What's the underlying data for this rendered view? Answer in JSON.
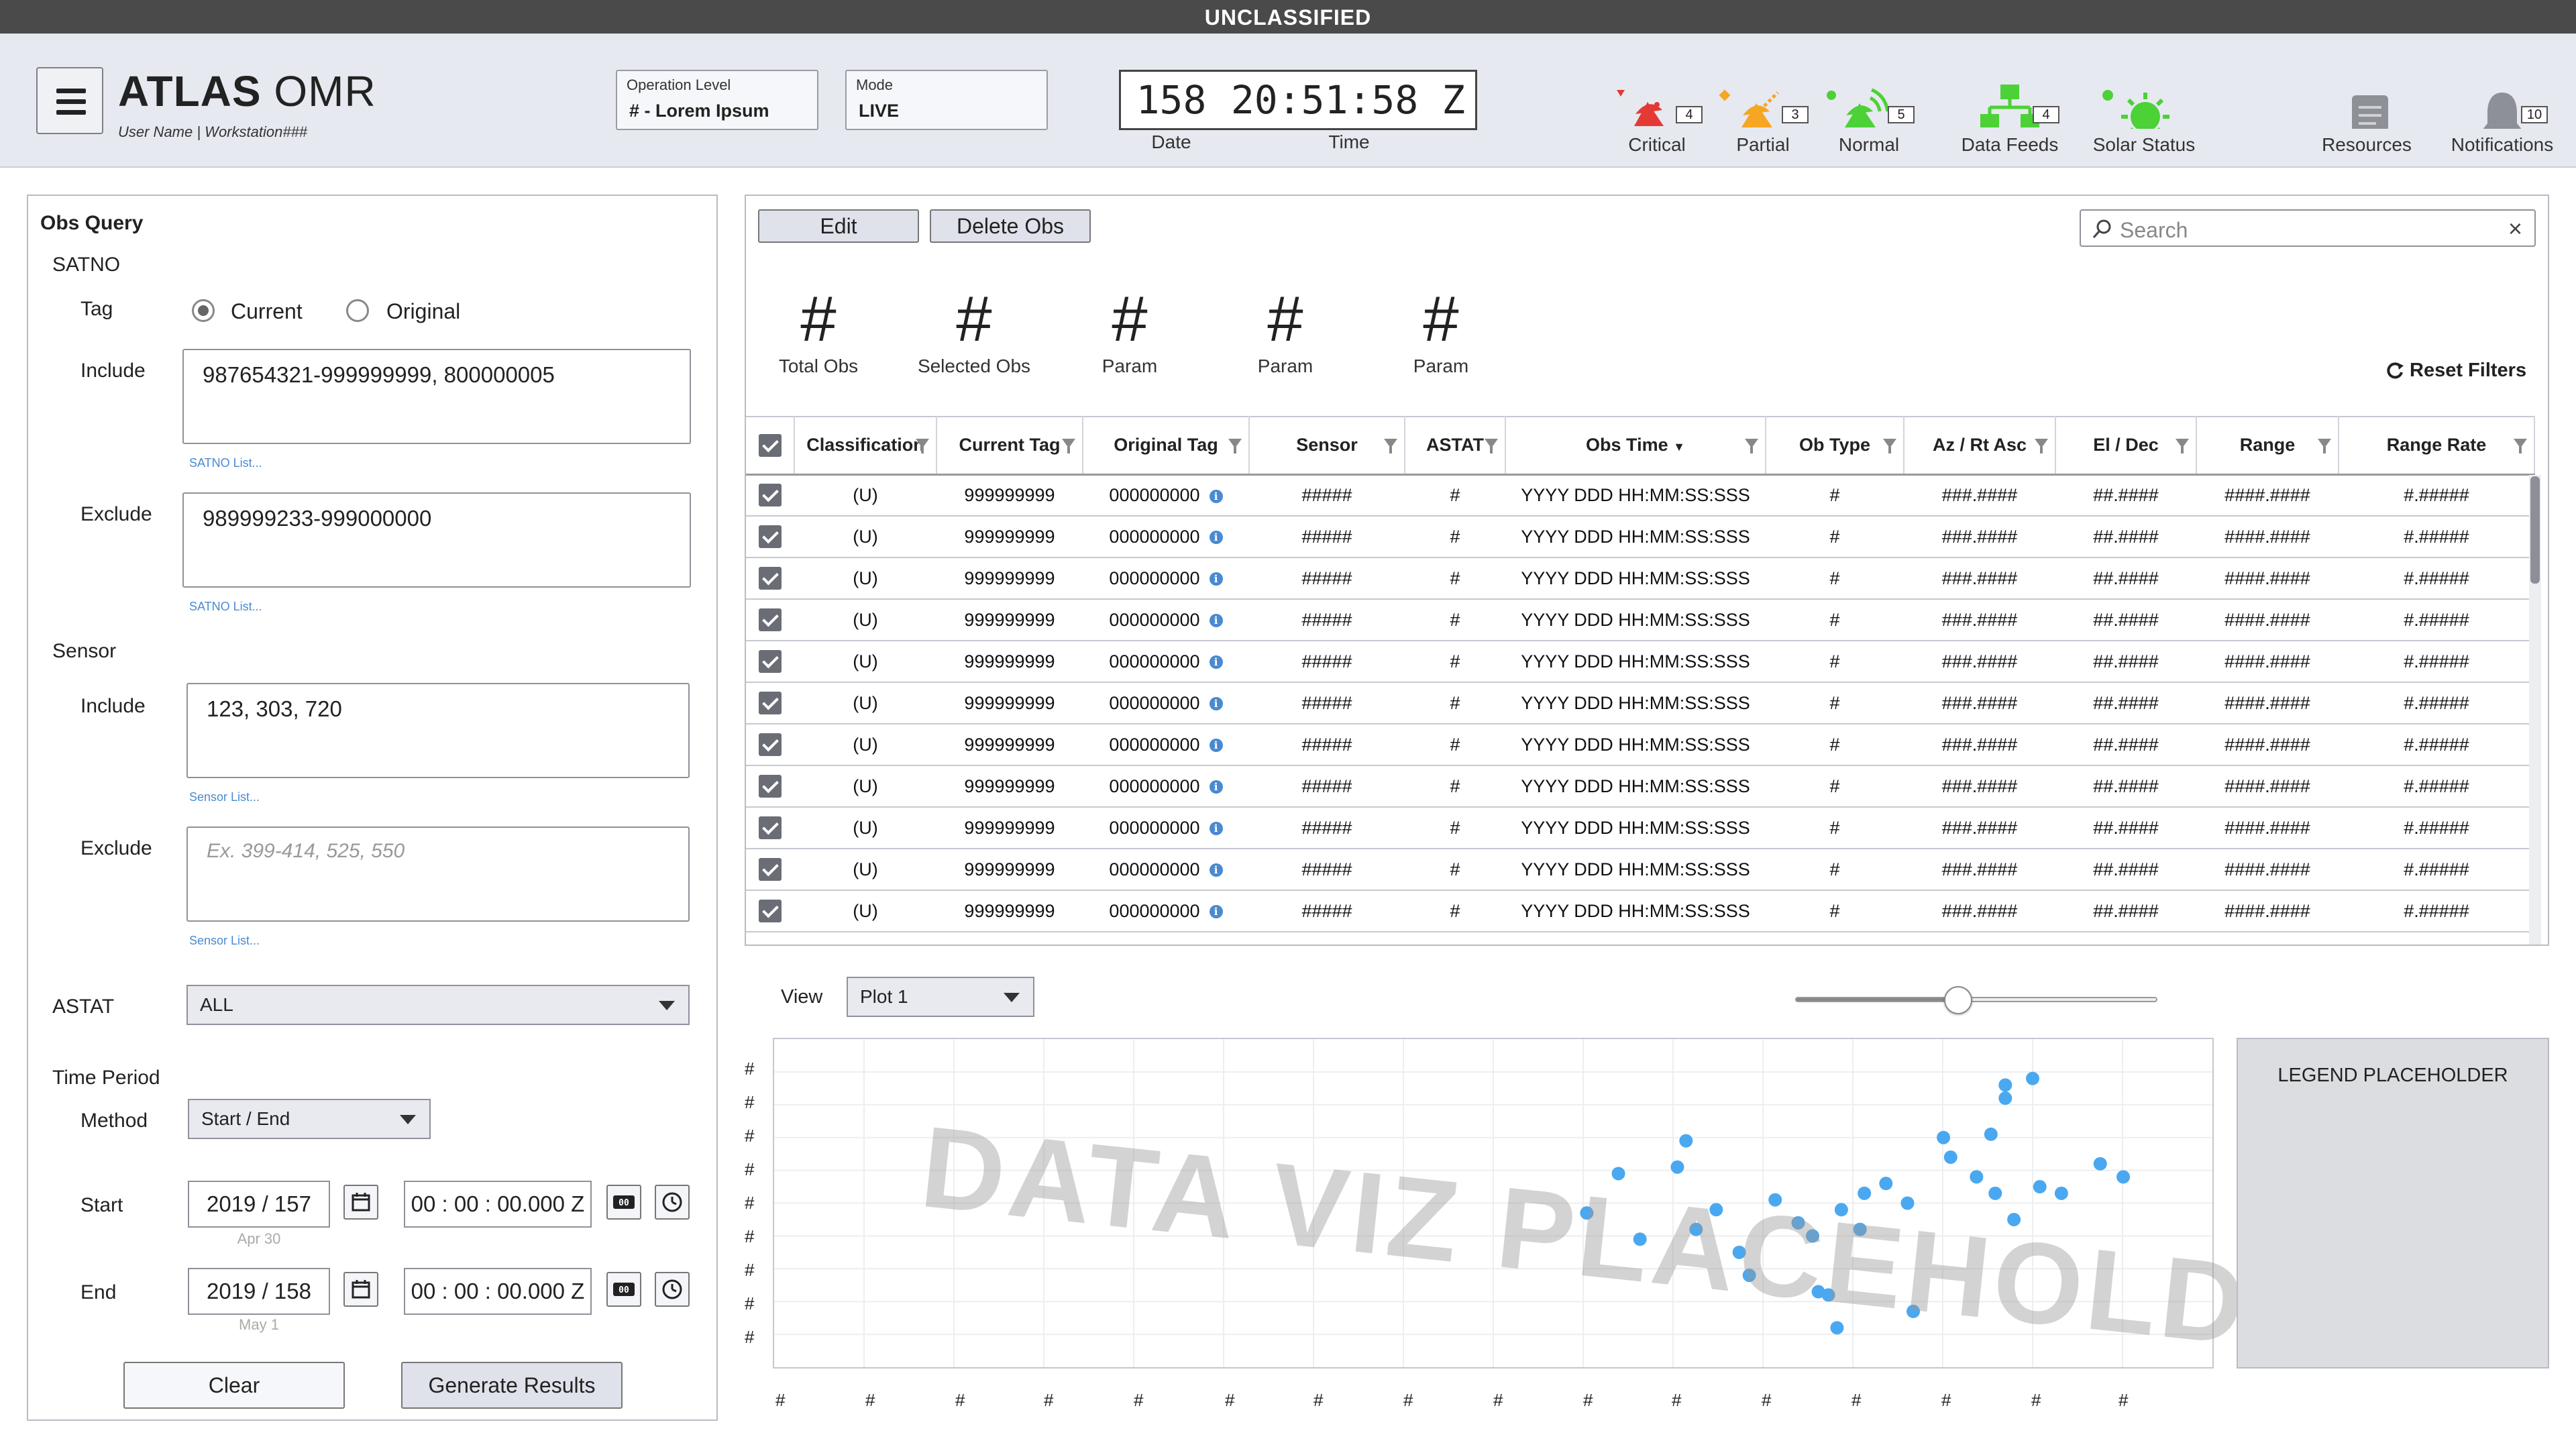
{
  "classification": "UNCLASSIFIED",
  "header": {
    "app_name_bold": "ATLAS",
    "app_name_light": "OMR",
    "user_line": "User Name | Workstation###",
    "operation_level": {
      "label": "Operation Level",
      "value": "# - Lorem Ipsum"
    },
    "mode": {
      "label": "Mode",
      "value": "LIVE"
    },
    "clock": {
      "date": "158",
      "time": "20:51:58 Z",
      "date_label": "Date",
      "time_label": "Time"
    },
    "status": [
      {
        "label": "Critical",
        "count": "4",
        "color": "#e53935",
        "icon": "satellite-dish-icon"
      },
      {
        "label": "Partial",
        "count": "3",
        "color": "#f5a623",
        "icon": "satellite-dish-icon"
      },
      {
        "label": "Normal",
        "count": "5",
        "color": "#4cd137",
        "icon": "satellite-dish-icon"
      },
      {
        "label": "Data Feeds",
        "count": "4",
        "color": "#4cd137",
        "icon": "network-icon"
      },
      {
        "label": "Solar Status",
        "count": "",
        "color": "#4cd137",
        "icon": "sun-icon"
      }
    ],
    "resources": {
      "label": "Resources",
      "icon": "document-icon"
    },
    "notifications": {
      "label": "Notifications",
      "count": "10",
      "icon": "bell-icon"
    }
  },
  "query": {
    "title": "Obs Query",
    "satno_label": "SATNO",
    "tag_label": "Tag",
    "tag_options": [
      "Current",
      "Original"
    ],
    "tag_selected": "Current",
    "include_label": "Include",
    "exclude_label": "Exclude",
    "satno_include": "987654321-999999999, 800000005",
    "satno_exclude": "989999233-999000000",
    "satno_list_link": "SATNO List...",
    "sensor_label": "Sensor",
    "sensor_include": "123, 303, 720",
    "sensor_exclude_placeholder": "Ex. 399-414, 525, 550",
    "sensor_list_link": "Sensor List...",
    "astat_label": "ASTAT",
    "astat_value": "ALL",
    "time_period_label": "Time Period",
    "method_label": "Method",
    "method_value": "Start / End",
    "start_label": "Start",
    "start_date": "2019 / 157",
    "start_date_sub": "Apr 30",
    "start_time": "00 : 00 : 00.000 Z",
    "end_label": "End",
    "end_date": "2019 / 158",
    "end_date_sub": "May 1",
    "end_time": "00 : 00 : 00.000 Z",
    "clear_label": "Clear",
    "generate_label": "Generate Results"
  },
  "toolbar": {
    "edit_label": "Edit",
    "delete_label": "Delete Obs",
    "search_placeholder": "Search",
    "reset_label": "Reset Filters"
  },
  "stats": [
    {
      "value": "#",
      "label": "Total Obs"
    },
    {
      "value": "#",
      "label": "Selected Obs"
    },
    {
      "value": "#",
      "label": "Param"
    },
    {
      "value": "#",
      "label": "Param"
    },
    {
      "value": "#",
      "label": "Param"
    }
  ],
  "table": {
    "columns": [
      "Classification",
      "Current Tag",
      "Original Tag",
      "Sensor",
      "ASTAT",
      "Obs Time",
      "Ob Type",
      "Az / Rt Asc",
      "El / Dec",
      "Range",
      "Range Rate"
    ],
    "rows": [
      [
        "(U)",
        "999999999",
        "000000000",
        "#####",
        "#",
        "YYYY DDD HH:MM:SS:SSS",
        "#",
        "###.####",
        "##.####",
        "####.####",
        "#.#####"
      ],
      [
        "(U)",
        "999999999",
        "000000000",
        "#####",
        "#",
        "YYYY DDD HH:MM:SS:SSS",
        "#",
        "###.####",
        "##.####",
        "####.####",
        "#.#####"
      ],
      [
        "(U)",
        "999999999",
        "000000000",
        "#####",
        "#",
        "YYYY DDD HH:MM:SS:SSS",
        "#",
        "###.####",
        "##.####",
        "####.####",
        "#.#####"
      ],
      [
        "(U)",
        "999999999",
        "000000000",
        "#####",
        "#",
        "YYYY DDD HH:MM:SS:SSS",
        "#",
        "###.####",
        "##.####",
        "####.####",
        "#.#####"
      ],
      [
        "(U)",
        "999999999",
        "000000000",
        "#####",
        "#",
        "YYYY DDD HH:MM:SS:SSS",
        "#",
        "###.####",
        "##.####",
        "####.####",
        "#.#####"
      ],
      [
        "(U)",
        "999999999",
        "000000000",
        "#####",
        "#",
        "YYYY DDD HH:MM:SS:SSS",
        "#",
        "###.####",
        "##.####",
        "####.####",
        "#.#####"
      ],
      [
        "(U)",
        "999999999",
        "000000000",
        "#####",
        "#",
        "YYYY DDD HH:MM:SS:SSS",
        "#",
        "###.####",
        "##.####",
        "####.####",
        "#.#####"
      ],
      [
        "(U)",
        "999999999",
        "000000000",
        "#####",
        "#",
        "YYYY DDD HH:MM:SS:SSS",
        "#",
        "###.####",
        "##.####",
        "####.####",
        "#.#####"
      ],
      [
        "(U)",
        "999999999",
        "000000000",
        "#####",
        "#",
        "YYYY DDD HH:MM:SS:SSS",
        "#",
        "###.####",
        "##.####",
        "####.####",
        "#.#####"
      ],
      [
        "(U)",
        "999999999",
        "000000000",
        "#####",
        "#",
        "YYYY DDD HH:MM:SS:SSS",
        "#",
        "###.####",
        "##.####",
        "####.####",
        "#.#####"
      ],
      [
        "(U)",
        "999999999",
        "000000000",
        "#####",
        "#",
        "YYYY DDD HH:MM:SS:SSS",
        "#",
        "###.####",
        "##.####",
        "####.####",
        "#.#####"
      ]
    ]
  },
  "viz": {
    "view_label": "View",
    "plot_value": "Plot 1",
    "zoom_level": 0.45,
    "watermark": "DATA VIZ PLACEHOLDER",
    "legend_placeholder": "LEGEND PLACEHOLDER",
    "y_ticks": [
      "#",
      "#",
      "#",
      "#",
      "#",
      "#",
      "#",
      "#",
      "#"
    ],
    "x_ticks": [
      "#",
      "#",
      "#",
      "#",
      "#",
      "#",
      "#",
      "#",
      "#",
      "#",
      "#",
      "#",
      "#",
      "#",
      "#",
      "#"
    ],
    "point_color": "#4aa8f0",
    "points": [
      [
        0.565,
        0.53
      ],
      [
        0.587,
        0.41
      ],
      [
        0.602,
        0.61
      ],
      [
        0.628,
        0.39
      ],
      [
        0.634,
        0.31
      ],
      [
        0.641,
        0.58
      ],
      [
        0.655,
        0.52
      ],
      [
        0.671,
        0.65
      ],
      [
        0.678,
        0.72
      ],
      [
        0.696,
        0.49
      ],
      [
        0.712,
        0.56
      ],
      [
        0.722,
        0.6
      ],
      [
        0.726,
        0.77
      ],
      [
        0.733,
        0.78
      ],
      [
        0.739,
        0.88
      ],
      [
        0.742,
        0.52
      ],
      [
        0.755,
        0.58
      ],
      [
        0.758,
        0.47
      ],
      [
        0.773,
        0.44
      ],
      [
        0.788,
        0.5
      ],
      [
        0.792,
        0.83
      ],
      [
        0.818,
        0.36
      ],
      [
        0.813,
        0.3
      ],
      [
        0.836,
        0.42
      ],
      [
        0.856,
        0.18
      ],
      [
        0.849,
        0.47
      ],
      [
        0.846,
        0.29
      ],
      [
        0.856,
        0.14
      ],
      [
        0.862,
        0.55
      ],
      [
        0.875,
        0.12
      ],
      [
        0.88,
        0.45
      ],
      [
        0.895,
        0.47
      ],
      [
        0.922,
        0.38
      ],
      [
        0.938,
        0.42
      ]
    ]
  }
}
